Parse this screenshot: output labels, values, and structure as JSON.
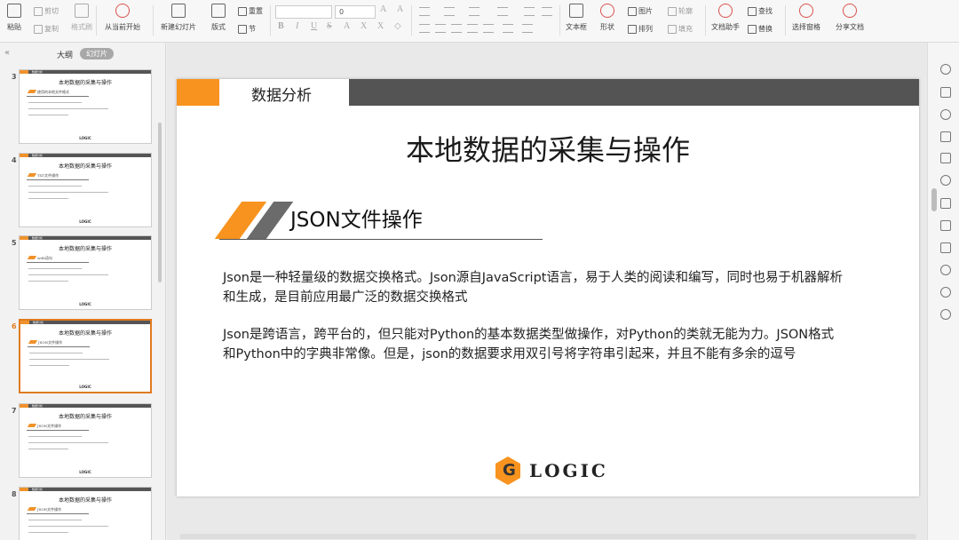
{
  "ribbon": {
    "paste": "粘贴",
    "cut": "剪切",
    "copy": "复制",
    "format_painter": "格式刷",
    "from_current": "从当前开始",
    "new_slide": "新建幻灯片",
    "layout": "版式",
    "reset": "重置",
    "section": "节",
    "font_size": "0",
    "text_box": "文本框",
    "shape": "形状",
    "picture": "图片",
    "arrange": "排列",
    "outline": "轮廓",
    "fill": "填充",
    "doc_assistant": "文档助手",
    "find": "查找",
    "replace": "替换",
    "selection_pane": "选择窗格",
    "share_doc": "分享文档"
  },
  "panel": {
    "collapse_glyph": "«",
    "tab_outline": "大纲",
    "tab_slides": "幻灯片",
    "selected_index": 3
  },
  "thumbnails": [
    {
      "num": "3",
      "section": "数据分析",
      "title": "本地数据的采集与操作",
      "heading": "使用的本地文件格式"
    },
    {
      "num": "4",
      "section": "数据分析",
      "title": "本地数据的采集与操作",
      "heading": "TXT文件操作"
    },
    {
      "num": "5",
      "section": "数据分析",
      "title": "本地数据的采集与操作",
      "heading": "with语句"
    },
    {
      "num": "6",
      "section": "数据分析",
      "title": "本地数据的采集与操作",
      "heading": "JSON文件操作"
    },
    {
      "num": "7",
      "section": "数据分析",
      "title": "本地数据的采集与操作",
      "heading": "JSON文件操作"
    },
    {
      "num": "8",
      "section": "数据分析",
      "title": "本地数据的采集与操作",
      "heading": "JSON文件操作"
    }
  ],
  "thumb_logo": "LOGIC",
  "slide": {
    "section": "数据分析",
    "title": "本地数据的采集与操作",
    "heading": "JSON文件操作",
    "para1": "Json是一种轻量级的数据交换格式。Json源自JavaScript语言，易于人类的阅读和编写，同时也易于机器解析和生成，是目前应用最广泛的数据交换格式",
    "para2": "Json是跨语言，跨平台的，但只能对Python的基本数据类型做操作，对Python的类就无能为力。JSON格式和Python中的字典非常像。但是，json的数据要求用双引号将字符串引起来，并且不能有多余的逗号",
    "logo": "LOGIC"
  },
  "colors": {
    "accent": "#f7931e",
    "dark_bar": "#545454",
    "selected": "#e07b20"
  }
}
